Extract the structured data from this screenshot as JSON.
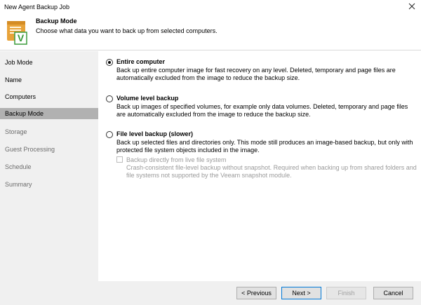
{
  "window": {
    "title": "New Agent Backup Job"
  },
  "header": {
    "title": "Backup Mode",
    "subtitle": "Choose what data you want to back up from selected computers.",
    "logo_letter": "V"
  },
  "sidebar": {
    "items": [
      {
        "label": "Job Mode"
      },
      {
        "label": "Name"
      },
      {
        "label": "Computers"
      },
      {
        "label": "Backup Mode"
      },
      {
        "label": "Storage"
      },
      {
        "label": "Guest Processing"
      },
      {
        "label": "Schedule"
      },
      {
        "label": "Summary"
      }
    ]
  },
  "options": {
    "entire": {
      "label": "Entire computer",
      "desc": "Back up entire computer image for fast recovery on any level. Deleted, temporary and page files are automatically excluded from the image to reduce the backup size."
    },
    "volume": {
      "label": "Volume level backup",
      "desc": "Back up images of specified volumes, for example only data volumes. Deleted, temporary and page files are automatically excluded from the image to reduce the backup size."
    },
    "file": {
      "label": "File level backup (slower)",
      "desc": "Back up selected files and directories only. This mode still produces an image-based backup, but only with protected file system objects included in the image.",
      "sub_label": "Backup directly from live file system",
      "sub_desc": "Crash-consistent file-level backup without snapshot. Required when backing up from shared folders and file systems not supported by the Veeam snapshot module."
    }
  },
  "buttons": {
    "previous": "< Previous",
    "next": "Next >",
    "finish": "Finish",
    "cancel": "Cancel"
  }
}
